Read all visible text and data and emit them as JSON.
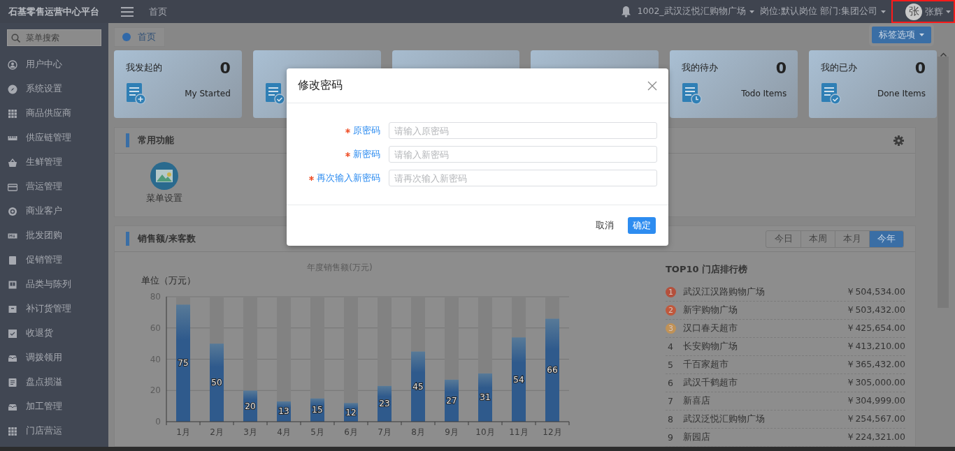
{
  "header": {
    "title": "石基零售运营中心平台",
    "nav_link": "首页",
    "store": "1002_武汉泛悦汇购物广场",
    "role": "岗位:默认岗位 部门:集团公司",
    "avatar": "张",
    "user": "张辉",
    "user_highlighted": true
  },
  "sidebar": {
    "search_placeholder": "菜单搜索",
    "items": [
      {
        "label": "用户中心"
      },
      {
        "label": "系统设置"
      },
      {
        "label": "商品供应商"
      },
      {
        "label": "供应链管理"
      },
      {
        "label": "生鲜管理"
      },
      {
        "label": "营运管理"
      },
      {
        "label": "商业客户"
      },
      {
        "label": "批发团购"
      },
      {
        "label": "促销管理"
      },
      {
        "label": "品类与陈列"
      },
      {
        "label": "补订货管理"
      },
      {
        "label": "收退货"
      },
      {
        "label": "调拨领用"
      },
      {
        "label": "盘点损溢"
      },
      {
        "label": "加工管理"
      },
      {
        "label": "门店营运"
      }
    ]
  },
  "tabs": [
    {
      "label": "首页",
      "selected": true
    }
  ],
  "tab_options_button": "标签选项",
  "cards": [
    {
      "title": "我发起的",
      "count": "0",
      "subtitle": "My Started",
      "kind": "plus"
    },
    {
      "kind": "check"
    },
    {
      "kind": "covered"
    },
    {
      "kind": "covered"
    },
    {
      "title": "我的待办",
      "count": "0",
      "subtitle": "Todo Items",
      "kind": "clock"
    },
    {
      "title": "我的已办",
      "count": "0",
      "subtitle": "Done Items",
      "kind": "check"
    }
  ],
  "common_functions": {
    "title": "常用功能",
    "items": [
      {
        "label": "菜单设置"
      }
    ]
  },
  "sales": {
    "title": "销售额/来客数",
    "periods": [
      {
        "label": "今日",
        "selected": false
      },
      {
        "label": "本周",
        "selected": false
      },
      {
        "label": "本月",
        "selected": false
      },
      {
        "label": "今年",
        "selected": true
      }
    ],
    "chart_data": {
      "type": "bar",
      "title": "年度销售额(万元)",
      "ylabel": "单位（万元）",
      "categories": [
        "1月",
        "2月",
        "3月",
        "4月",
        "5月",
        "6月",
        "7月",
        "8月",
        "9月",
        "10月",
        "11月",
        "12月"
      ],
      "series": [
        {
          "color": "#2f5a8c",
          "values": [
            75,
            50,
            20,
            13,
            15,
            12,
            23,
            45,
            27,
            31,
            54,
            66
          ],
          "value_labels": [
            "75",
            "50",
            "20",
            "13",
            "15",
            "12",
            "23",
            "45",
            "27",
            "31",
            "54",
            "66"
          ]
        },
        {
          "color": "#828282",
          "values": [
            5,
            30,
            60,
            67,
            65,
            68,
            57,
            35,
            53,
            49,
            26,
            14
          ],
          "value_labels": [
            null,
            null,
            null,
            null,
            null,
            null,
            null,
            null,
            null,
            null,
            null,
            null
          ]
        }
      ],
      "ylim": [
        0,
        80
      ],
      "yticks": [
        0,
        20,
        40,
        60,
        80
      ],
      "grid": true,
      "stacked": true
    },
    "ranking": {
      "title": "TOP10 门店排行榜",
      "rows": [
        {
          "rank": "1",
          "name": "武汉江汉路购物广场",
          "amount": "￥504,534.00",
          "kind": "badge",
          "color": "#b4503c"
        },
        {
          "rank": "2",
          "name": "新宇购物广场",
          "amount": "￥503,432.00",
          "kind": "badge",
          "color": "#c0583c"
        },
        {
          "rank": "3",
          "name": "汉口春天超市",
          "amount": "￥425,654.00",
          "kind": "badge",
          "color": "#c09257"
        },
        {
          "rank": "4",
          "name": "长安购物广场",
          "amount": "￥413,210.00",
          "kind": "plain"
        },
        {
          "rank": "5",
          "name": "千百家超市",
          "amount": "￥365,432.00",
          "kind": "plain"
        },
        {
          "rank": "6",
          "name": "武汉千鹤超市",
          "amount": "￥305,000.00",
          "kind": "plain"
        },
        {
          "rank": "7",
          "name": "新喜店",
          "amount": "￥304,999.00",
          "kind": "plain"
        },
        {
          "rank": "8",
          "name": "武汉泛悦汇购物广场",
          "amount": "￥254,567.00",
          "kind": "plain"
        },
        {
          "rank": "9",
          "name": "新园店",
          "amount": "￥224,321.00",
          "kind": "plain"
        }
      ]
    }
  },
  "dialog": {
    "title": "修改密码",
    "fields": [
      {
        "label": "原密码",
        "placeholder": "请输入原密码",
        "required": true
      },
      {
        "label": "新密码",
        "placeholder": "请输入新密码",
        "required": true
      },
      {
        "label": "再次输入新密码",
        "placeholder": "请再次输入新密码",
        "required": true
      }
    ],
    "cancel": "取消",
    "confirm": "确定"
  }
}
